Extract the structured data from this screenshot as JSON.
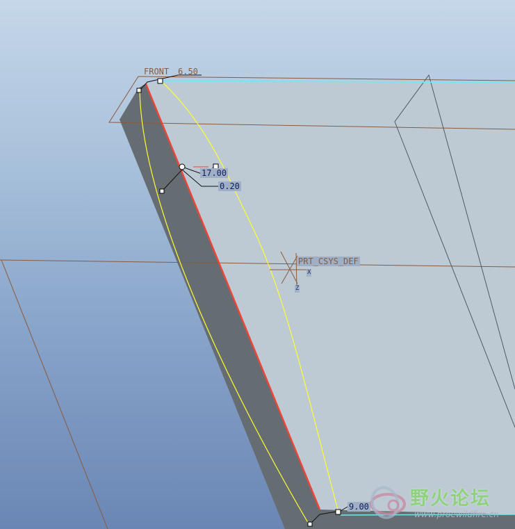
{
  "viewport": {
    "datum_planes": {
      "front": "FRONT"
    },
    "csys": {
      "name": "PRT_CSYS_DEF",
      "axis_x": "X",
      "axis_z": "Z"
    },
    "dimensions": [
      "6.50",
      "17.00",
      "0.20",
      "9.00"
    ]
  },
  "colors": {
    "background_top": "#c5d7e8",
    "background_bottom": "#6a86b4",
    "datum_plane": "#8a5a3c",
    "sketch_curve": "#ffff33",
    "selected_edge": "#e8473a",
    "highlight_edge": "#6ee9f0",
    "dimension_box": "#9fb0c6"
  },
  "watermark": {
    "title": "野火论坛",
    "url": "www.proewildfire.cn"
  }
}
